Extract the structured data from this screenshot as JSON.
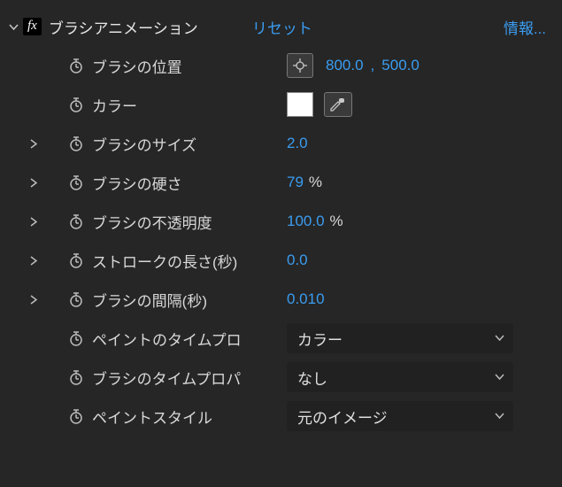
{
  "header": {
    "fx_badge": "fx",
    "effect_name": "ブラシアニメーション",
    "reset": "リセット",
    "about": "情報..."
  },
  "props": {
    "brush_position": {
      "label": "ブラシの位置",
      "x": "800.0",
      "y": "500.0"
    },
    "color": {
      "label": "カラー",
      "swatch": "#ffffff"
    },
    "brush_size": {
      "label": "ブラシのサイズ",
      "value": "2.0"
    },
    "brush_hardness": {
      "label": "ブラシの硬さ",
      "value": "79",
      "unit": "%"
    },
    "brush_opacity": {
      "label": "ブラシの不透明度",
      "value": "100.0",
      "unit": "%"
    },
    "stroke_length": {
      "label": "ストロークの長さ(秒)",
      "value": "0.0"
    },
    "brush_spacing": {
      "label": "ブラシの間隔(秒)",
      "value": "0.010"
    },
    "paint_time_prop": {
      "label": "ペイントのタイムプロ",
      "selected": "カラー"
    },
    "brush_time_prop": {
      "label": "ブラシのタイムプロパ",
      "selected": "なし"
    },
    "paint_style": {
      "label": "ペイントスタイル",
      "selected": "元のイメージ"
    }
  }
}
